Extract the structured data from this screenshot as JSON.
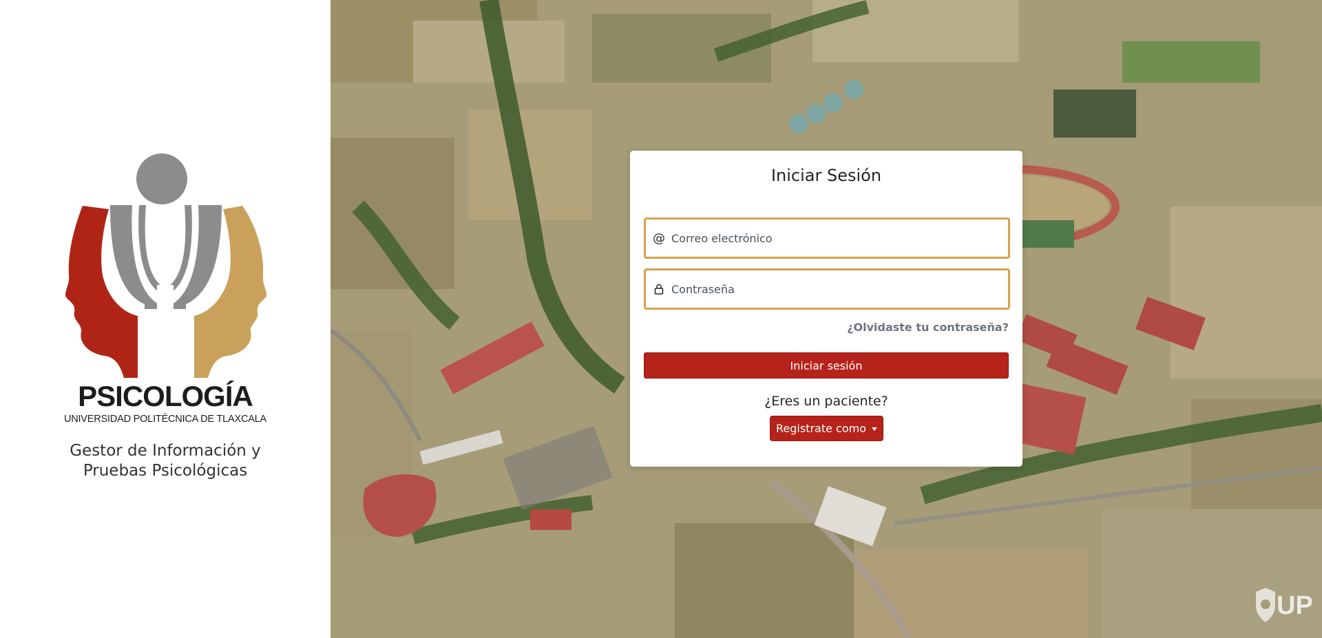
{
  "brand": {
    "title": "PSICOLOGÍA",
    "subtitle": "UNIVERSIDAD POLITÉCNICA DE TLAXCALA",
    "app_name": "Gestor de Información y Pruebas Psicológicas",
    "colors": {
      "red": "#b02416",
      "gray": "#8c8c8c",
      "gold": "#c9a15b"
    }
  },
  "login": {
    "title": "Iniciar Sesión",
    "email_placeholder": "Correo electrónico",
    "email_value": "",
    "password_placeholder": "Contraseña",
    "password_value": "",
    "forgot_link": "¿Olvidaste tu contraseña?",
    "submit_label": "Iniciar sesión",
    "patient_question": "¿Eres un paciente?",
    "register_label": "Registrate como",
    "accent": "#b5231a",
    "field_border": "#d4a24a"
  },
  "icons": {
    "email": "at-icon",
    "password": "lock-icon",
    "dropdown": "caret-down-icon"
  },
  "watermark": {
    "text": "UP"
  }
}
